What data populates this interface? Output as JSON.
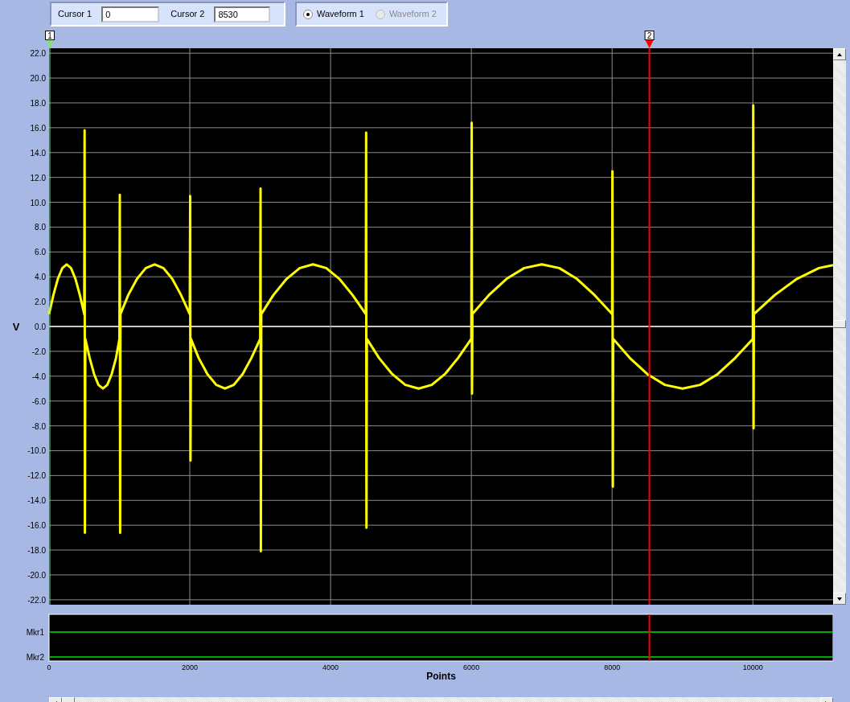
{
  "cursor_panel": {
    "cursors": [
      {
        "label": "Cursor 1",
        "value": "0",
        "marker": "1",
        "color": "#80e080"
      },
      {
        "label": "Cursor 2",
        "value": "8530",
        "marker": "2",
        "color": "#ff0000"
      }
    ]
  },
  "waveform_selector": [
    {
      "label": "Waveform 1",
      "selected": true,
      "disabled": false
    },
    {
      "label": "Waveform 2",
      "selected": false,
      "disabled": true
    }
  ],
  "plot": {
    "markers": [
      "Mkr1",
      "Mkr2"
    ],
    "chart_data": {
      "type": "line",
      "grid": true,
      "ref_lines": [
        {
          "axis": "x",
          "value": 8530,
          "color": "#ff0000"
        }
      ],
      "xlabel": "Points",
      "ylabel": "V",
      "xlim": [
        0,
        11140
      ],
      "ylim": [
        -22.4,
        22.4
      ],
      "xticks": [
        0,
        2000,
        4000,
        6000,
        8000,
        10000
      ],
      "yticks": [
        {
          "value": 22,
          "label": "22.0"
        },
        {
          "value": 20,
          "label": "20.0"
        },
        {
          "value": 18,
          "label": "18.0"
        },
        {
          "value": 16,
          "label": "16.0"
        },
        {
          "value": 14,
          "label": "14.0"
        },
        {
          "value": 12,
          "label": "12.0"
        },
        {
          "value": 10,
          "label": "10.0"
        },
        {
          "value": 8,
          "label": "8.0"
        },
        {
          "value": 6,
          "label": "6.0"
        },
        {
          "value": 4,
          "label": "4.0"
        },
        {
          "value": 2,
          "label": "2.0"
        },
        {
          "value": 0,
          "label": "0.0"
        },
        {
          "value": -2,
          "label": "-2.0"
        },
        {
          "value": -4,
          "label": "-4.0"
        },
        {
          "value": -6,
          "label": "-6.0"
        },
        {
          "value": -8,
          "label": "-8.0"
        },
        {
          "value": -10,
          "label": "-10.0"
        },
        {
          "value": -12,
          "label": "-12.0"
        },
        {
          "value": -14,
          "label": "-14.0"
        },
        {
          "value": -16,
          "label": "-16.0"
        },
        {
          "value": -18,
          "label": "-18.0"
        },
        {
          "value": -20,
          "label": "-20.0"
        },
        {
          "value": -22,
          "label": "-22.0"
        }
      ],
      "x": [
        0,
        62,
        125,
        188,
        250,
        312,
        375,
        438,
        500,
        505,
        510,
        515,
        577,
        640,
        702,
        765,
        827,
        890,
        952,
        1000,
        1005,
        1010,
        1015,
        1125,
        1250,
        1375,
        1500,
        1625,
        1750,
        1875,
        2000,
        2005,
        2010,
        2015,
        2125,
        2250,
        2375,
        2500,
        2625,
        2750,
        2875,
        3000,
        3005,
        3010,
        3015,
        3188,
        3375,
        3562,
        3750,
        3938,
        4125,
        4312,
        4500,
        4505,
        4510,
        4515,
        4688,
        4875,
        5062,
        5250,
        5438,
        5625,
        5812,
        6000,
        6005,
        6010,
        6015,
        6250,
        6500,
        6750,
        7000,
        7250,
        7500,
        7750,
        8000,
        8005,
        8010,
        8015,
        8250,
        8500,
        8750,
        9000,
        9250,
        9500,
        9750,
        10000,
        10005,
        10010,
        10015,
        10312,
        10625,
        10938,
        11140
      ],
      "series": [
        {
          "color": "#ffff00",
          "values": [
            1,
            2.53,
            3.83,
            4.7,
            5,
            4.7,
            3.83,
            2.53,
            1,
            15.8,
            -16.6,
            -1,
            -2.53,
            -3.83,
            -4.7,
            -5,
            -4.7,
            -3.83,
            -2.53,
            -1,
            10.6,
            -16.6,
            1,
            2.53,
            3.83,
            4.7,
            5,
            4.7,
            3.83,
            2.53,
            1,
            10.5,
            -10.8,
            -1,
            -2.53,
            -3.83,
            -4.7,
            -5,
            -4.7,
            -3.83,
            -2.53,
            -1,
            11.1,
            -18.1,
            1,
            2.53,
            3.83,
            4.7,
            5,
            4.7,
            3.83,
            2.53,
            1,
            15.6,
            -16.2,
            -1,
            -2.53,
            -3.83,
            -4.7,
            -5,
            -4.7,
            -3.83,
            -2.53,
            -1,
            16.4,
            -5.4,
            1,
            2.53,
            3.83,
            4.7,
            5,
            4.7,
            3.83,
            2.53,
            1,
            12.5,
            -12.9,
            -1,
            -2.53,
            -3.83,
            -4.7,
            -5,
            -4.7,
            -3.83,
            -2.53,
            -1,
            17.8,
            -8.2,
            1,
            2.53,
            3.83,
            4.7,
            4.94
          ]
        }
      ]
    }
  }
}
